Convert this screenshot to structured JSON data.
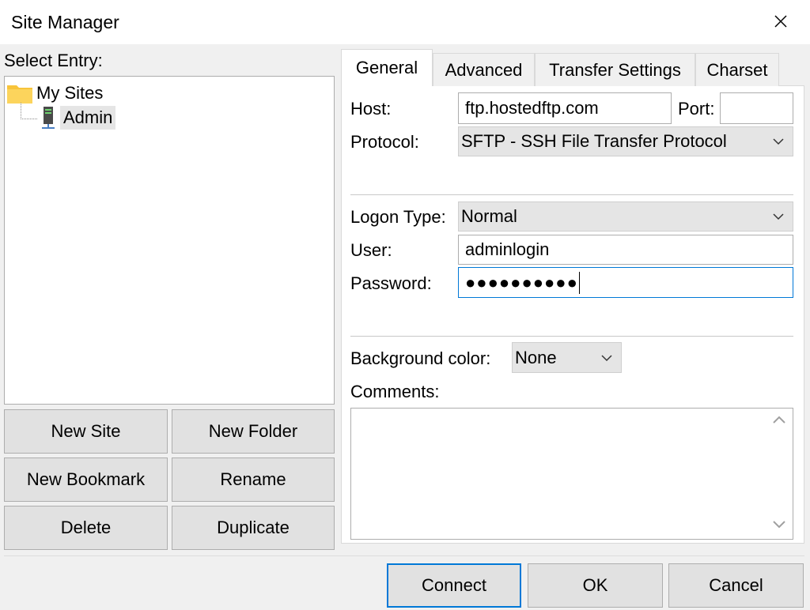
{
  "window": {
    "title": "Site Manager",
    "close_glyph": "✕"
  },
  "left": {
    "select_label": "Select Entry:",
    "tree": [
      {
        "label": "My Sites",
        "icon": "folder-icon"
      },
      {
        "label": "Admin",
        "icon": "server-icon",
        "selected": true
      }
    ],
    "buttons": {
      "new_site": "New Site",
      "new_folder": "New Folder",
      "new_bookmark": "New Bookmark",
      "rename": "Rename",
      "delete": "Delete",
      "duplicate": "Duplicate"
    }
  },
  "tabs": [
    "General",
    "Advanced",
    "Transfer Settings",
    "Charset"
  ],
  "active_tab": "General",
  "general": {
    "host_label": "Host:",
    "host_value": "ftp.hostedftp.com",
    "port_label": "Port:",
    "port_value": "",
    "protocol_label": "Protocol:",
    "protocol_value": "SFTP - SSH File Transfer Protocol",
    "logon_type_label": "Logon Type:",
    "logon_type_value": "Normal",
    "user_label": "User:",
    "user_value": "adminlogin",
    "password_label": "Password:",
    "password_value": "●●●●●●●●●●",
    "bg_color_label": "Background color:",
    "bg_color_value": "None",
    "comments_label": "Comments:",
    "comments_value": ""
  },
  "dialog_buttons": {
    "connect": "Connect",
    "ok": "OK",
    "cancel": "Cancel"
  },
  "colors": {
    "focus_border": "#0078d7",
    "folder": "#f8c43a"
  }
}
